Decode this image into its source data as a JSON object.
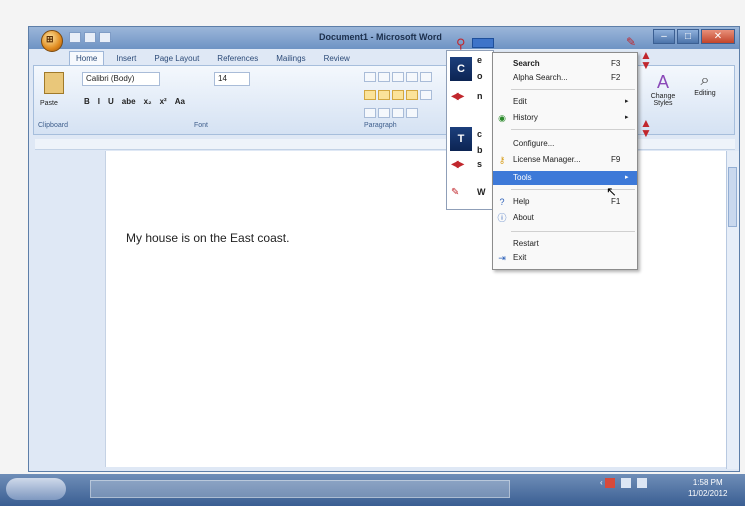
{
  "window": {
    "title": "Document1 - Microsoft Word",
    "controls": [
      "–",
      "□",
      "✕"
    ]
  },
  "ribbon": {
    "tabs": [
      "Home",
      "Insert",
      "Page Layout",
      "References",
      "Mailings",
      "Review"
    ],
    "active_tab": "Home",
    "paste_label": "Paste",
    "clipboard_label": "Clipboard",
    "font_name": "Calibri (Body)",
    "font_size": "14",
    "format_buttons": [
      "B",
      "I",
      "U",
      "abe",
      "x₂",
      "x²",
      "Aa"
    ],
    "font_label": "Font",
    "paragraph_label": "Paragraph",
    "change_styles_label": "Change Styles",
    "editing_label": "Editing"
  },
  "document": {
    "text": "My house is on the East coast."
  },
  "lingo_panel": {
    "tile_a": "C",
    "tile_b": "T",
    "letters": [
      "e",
      "o",
      "n",
      "c",
      "b",
      "s",
      "W"
    ]
  },
  "context_menu": {
    "items": [
      {
        "label": "Search",
        "shortcut": "F3",
        "bold": true
      },
      {
        "label": "Alpha Search...",
        "shortcut": "F2"
      },
      {
        "label": "Edit",
        "arrow": "▸"
      },
      {
        "label": "History",
        "arrow": "▸"
      },
      {
        "label": "Configure..."
      },
      {
        "label": "License Manager...",
        "shortcut": "F9"
      },
      {
        "label": "Tools",
        "arrow": "▸",
        "highlighted": true
      },
      {
        "label": "Help",
        "shortcut": "F1"
      },
      {
        "label": "About"
      },
      {
        "label": "Restart"
      },
      {
        "label": "Exit"
      }
    ]
  },
  "taskbar": {
    "clock_time": "1:58 PM",
    "clock_date": "11/02/2012"
  },
  "colors": {
    "menu_highlight": "#3d79d8",
    "brand_red": "#c1272d",
    "title_bar": "#6e93c4"
  }
}
